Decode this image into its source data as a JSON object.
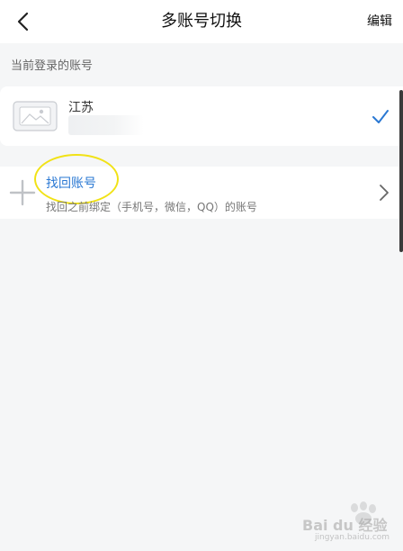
{
  "header": {
    "title": "多账号切换",
    "edit_label": "编辑"
  },
  "section": {
    "current_label": "当前登录的账号"
  },
  "current_account": {
    "name": "江苏"
  },
  "find_account": {
    "title": "找回账号",
    "description": "找回之前绑定（手机号，微信，QQ）的账号"
  },
  "watermark": {
    "text": "Bai du 经验",
    "url": "jingyan.baidu.com"
  },
  "colors": {
    "accent": "#2a78d3",
    "highlight": "#f1e216",
    "background": "#f5f6f7"
  }
}
